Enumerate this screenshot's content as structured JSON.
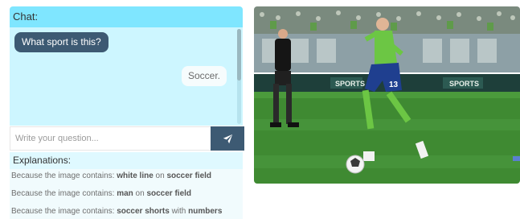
{
  "chat": {
    "title": "Chat:",
    "messages": [
      {
        "role": "user",
        "text": "What sport is this?"
      },
      {
        "role": "bot",
        "text": "Soccer."
      }
    ],
    "input_placeholder": "Write your question...",
    "send_icon": "paper-plane-icon"
  },
  "explanations": {
    "title": "Explanations:",
    "items": [
      {
        "prefix": "Because the image contains:",
        "a": "white line",
        "join": "on",
        "b": "soccer field"
      },
      {
        "prefix": "Because the image contains:",
        "a": "man",
        "join": "on",
        "b": "soccer field"
      },
      {
        "prefix": "Because the image contains:",
        "a": "soccer shorts",
        "join": "with",
        "b": "numbers"
      }
    ]
  },
  "photo": {
    "banner_text": "SPORTS",
    "shorts_number": "13",
    "colors": {
      "pitch": "#3f8a32",
      "jersey": "#6cc644",
      "shorts": "#1f3f8f"
    }
  }
}
